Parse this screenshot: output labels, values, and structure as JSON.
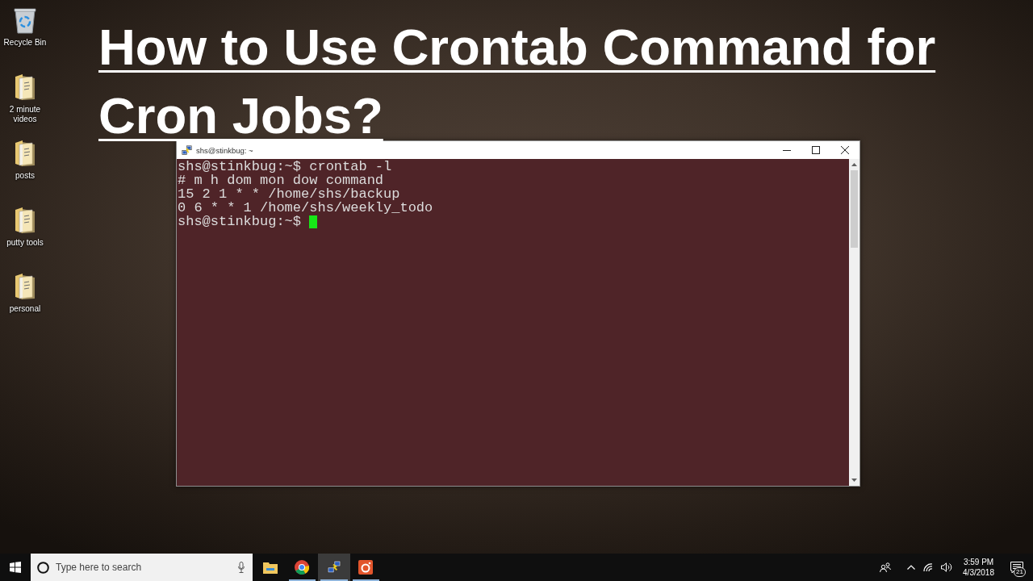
{
  "desktop_icons": [
    {
      "label": "Recycle Bin",
      "kind": "recycle-bin"
    },
    {
      "label": "2 minute videos",
      "kind": "folder"
    },
    {
      "label": "posts",
      "kind": "folder"
    },
    {
      "label": "putty tools",
      "kind": "folder"
    },
    {
      "label": "personal",
      "kind": "folder"
    }
  ],
  "title_overlay": {
    "lines": [
      "How to Use Crontab Command for",
      "Cron Jobs?"
    ]
  },
  "terminal": {
    "title": "shs@stinkbug: ~",
    "lines": [
      "shs@stinkbug:~$ crontab -l",
      "# m h dom mon dow command",
      "15 2 1 * * /home/shs/backup",
      "0 6 * * 1 /home/shs/weekly_todo"
    ],
    "prompt": "shs@stinkbug:~$",
    "cursor_shown": true
  },
  "taskbar": {
    "search": {
      "placeholder": "Type here to search"
    },
    "apps": [
      {
        "kind": "file-explorer",
        "running": false,
        "selected": false
      },
      {
        "kind": "browser",
        "running": true,
        "selected": false
      },
      {
        "kind": "putty",
        "running": true,
        "selected": true
      },
      {
        "kind": "camera",
        "running": true,
        "selected": false
      }
    ],
    "time": "3:59 PM",
    "date": "4/3/2018",
    "notification_count": "21"
  }
}
